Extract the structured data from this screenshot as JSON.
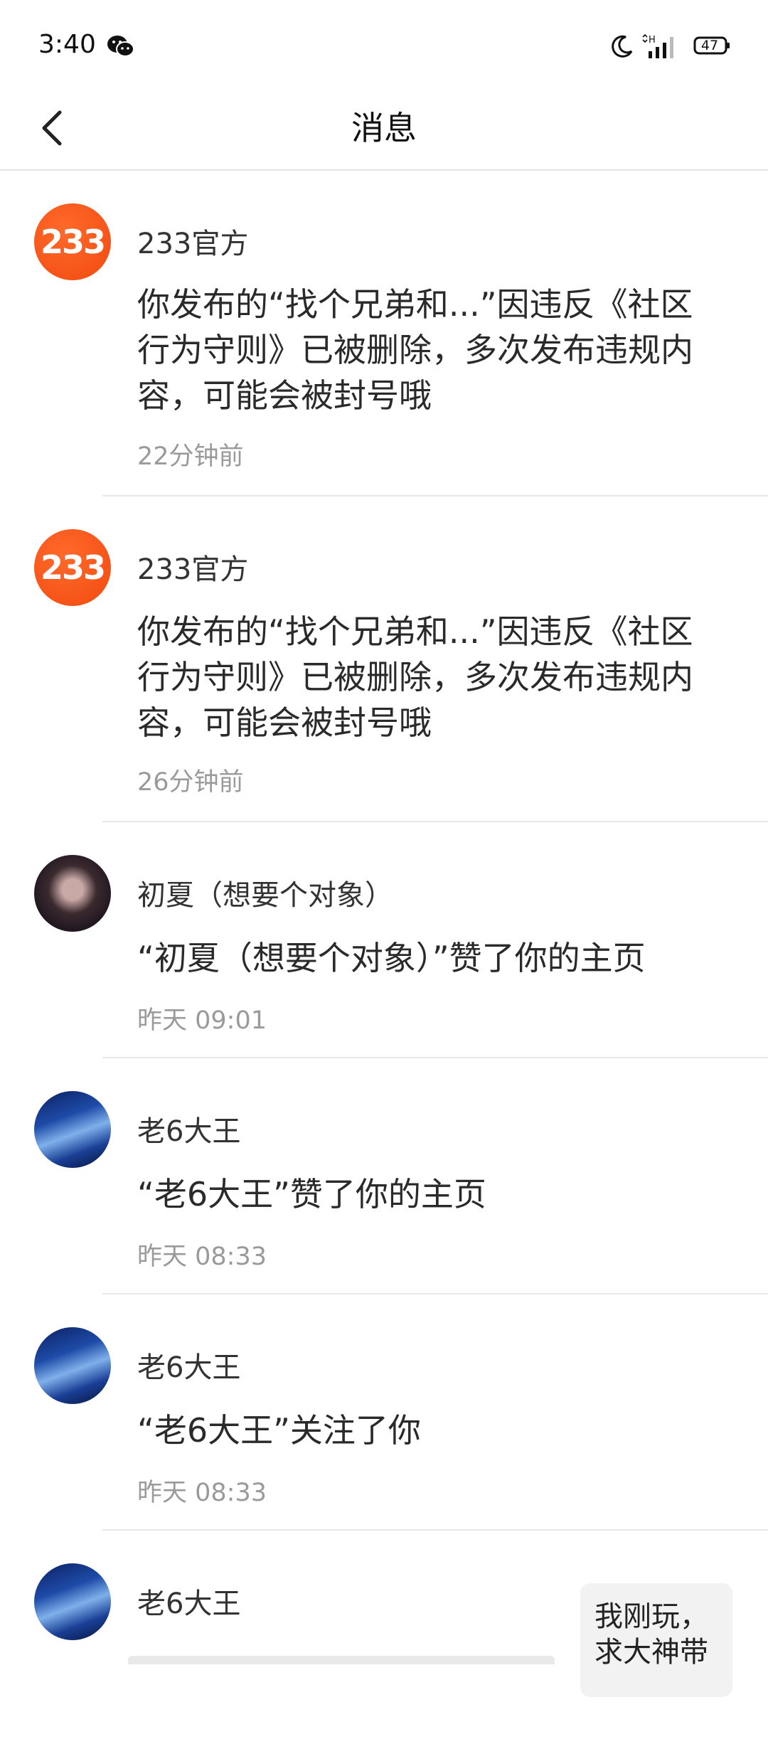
{
  "status_bar": {
    "time": "3:40",
    "battery": "47",
    "icons": [
      "wechat-icon",
      "moon-icon",
      "signal-icon",
      "battery-icon"
    ]
  },
  "header": {
    "title": "消息",
    "back_icon": "chevron-left-icon"
  },
  "messages": [
    {
      "sender": "233官方",
      "avatar_text": "233",
      "content": "你发布的“找个兄弟和...”因违反《社区行为守则》已被删除，多次发布违规内容，可能会被封号哦",
      "time": "22分钟前"
    },
    {
      "sender": "233官方",
      "avatar_text": "233",
      "content": "你发布的“找个兄弟和...”因违反《社区行为守则》已被删除，多次发布违规内容，可能会被封号哦",
      "time": "26分钟前"
    },
    {
      "sender": "初夏（想要个对象）",
      "content": "“初夏（想要个对象）”赞了你的主页",
      "time": "昨天 09:01"
    },
    {
      "sender": "老6大王",
      "content": "“老6大王”赞了你的主页",
      "time": "昨天 08:33"
    },
    {
      "sender": "老6大王",
      "content": "“老6大王”关注了你",
      "time": "昨天 08:33"
    },
    {
      "sender": "老6大王"
    }
  ],
  "floating_bubble": {
    "text": "我刚玩，求大神带"
  },
  "colors": {
    "brand_orange": "#f24a0f",
    "divider": "#e8e8e8",
    "time_gray": "#9a9a9a"
  }
}
